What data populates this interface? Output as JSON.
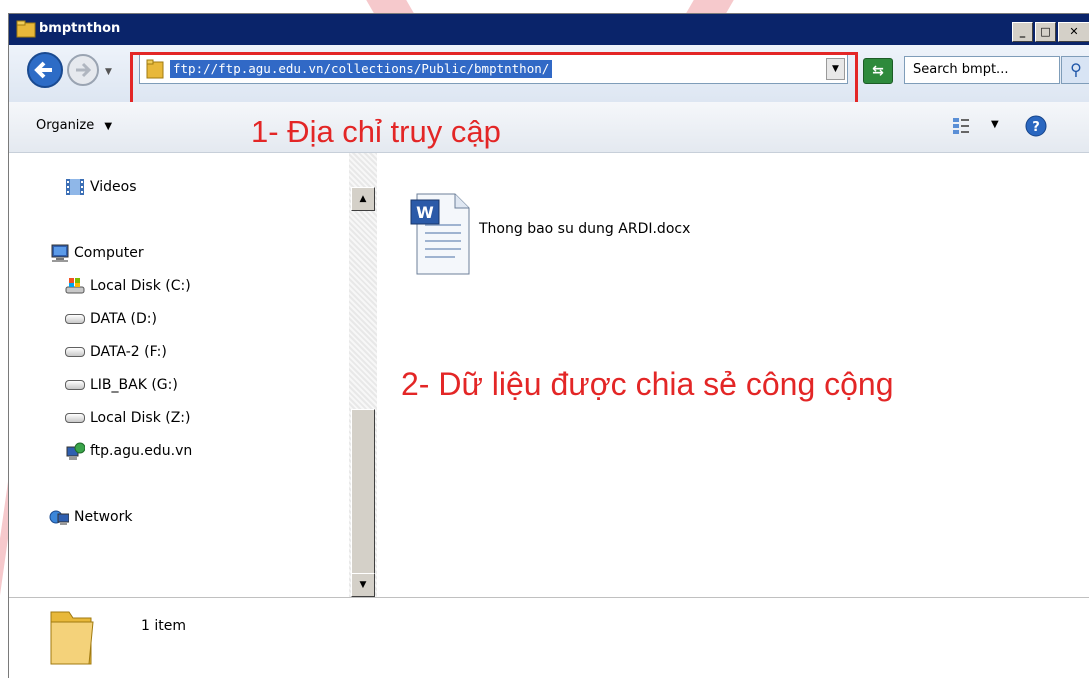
{
  "window": {
    "title": "bmptnthon"
  },
  "navbar": {
    "address": "ftp://ftp.agu.edu.vn/collections/Public/bmptnthon/",
    "search_placeholder": "Search bmpt..."
  },
  "toolbar": {
    "organize_label": "Organize"
  },
  "annotations": {
    "address_label": "1- Địa chỉ truy cập",
    "data_label": "2- Dữ liệu được chia sẻ công cộng"
  },
  "nav_pane": {
    "items": [
      {
        "label": "Videos",
        "icon": "videos-icon"
      },
      {
        "label": "Computer",
        "icon": "computer-icon"
      },
      {
        "label": "Local Disk (C:)",
        "icon": "system-drive-icon"
      },
      {
        "label": "DATA (D:)",
        "icon": "drive-icon"
      },
      {
        "label": "DATA-2 (F:)",
        "icon": "drive-icon"
      },
      {
        "label": "LIB_BAK (G:)",
        "icon": "drive-icon"
      },
      {
        "label": "Local Disk (Z:)",
        "icon": "drive-icon"
      },
      {
        "label": "ftp.agu.edu.vn",
        "icon": "network-location-icon"
      },
      {
        "label": "Network",
        "icon": "network-icon"
      }
    ]
  },
  "files": [
    {
      "name": "Thong bao su dung ARDI.docx",
      "icon": "word-document-icon"
    }
  ],
  "status": {
    "count": "1 item"
  },
  "colors": {
    "titlebar": "#0a246a",
    "annotation_red": "#e32626",
    "selection": "#3169c6"
  }
}
